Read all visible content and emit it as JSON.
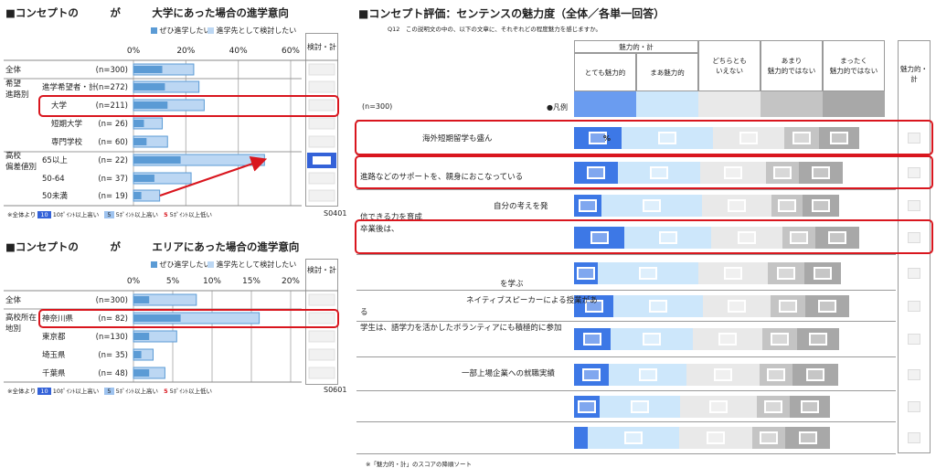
{
  "left_top": {
    "title": "■コンセプトの　　　が　　　大学にあった場合の進学意向",
    "legend": [
      "ぜひ進学したい",
      "進学先として検討したい"
    ],
    "side_header": "検討・計",
    "code": "S0401",
    "footnote": [
      "※全体より",
      "10",
      "10ﾎﾟｲﾝﾄ以上高い",
      "5",
      "5ﾎﾟｲﾝﾄ以上高い",
      "5",
      "5ﾎﾟｲﾝﾄ以上低い"
    ],
    "groups": [
      "希望\n進路別",
      "高校\n偏差値別"
    ]
  },
  "left_bottom": {
    "title": "■コンセプトの　　　が　　　エリアにあった場合の進学意向",
    "legend": [
      "ぜひ進学したい",
      "進学先として検討したい"
    ],
    "side_header": "検討・計",
    "code": "S0601",
    "footnote": [
      "※全体より",
      "10",
      "10ﾎﾟｲﾝﾄ以上高い",
      "5",
      "5ﾎﾟｲﾝﾄ以上高い",
      "5",
      "5ﾎﾟｲﾝﾄ以上低い"
    ],
    "groups": [
      "高校所在\n地別"
    ]
  },
  "right": {
    "title": "■コンセプト評価：センテンスの魅力度（全体／各単一回答）",
    "question": "Q12　この説明文の中の、以下の文章に、それぞれどの程度魅力を感じますか。",
    "header_group": "魅力的・計",
    "header_total": "魅力的・計",
    "columns": [
      "とても魅力的",
      "まあ魅力的",
      "どちらとも\nいえない",
      "あまり\n魅力的ではない",
      "まったく\n魅力的ではない"
    ],
    "n_label": "(n=300)",
    "legend_label": "●凡例",
    "pct_mark": "%",
    "footnote": "※「魅力的・計」のスコアの降順ソート",
    "rows": [
      "海外短期留学も盛ん",
      "進路などのサポートを、親身におこなっている",
      "自分の考えを発",
      "信できる力を育成",
      "卒業後は、",
      "を学ぶ",
      "ネイティブスピーカーによる授業があ",
      "る",
      "学生は、語学力を活かしたボランティアにも積極的に参加",
      "一部上場企業への就職実績"
    ]
  },
  "chart_data": [
    {
      "type": "bar",
      "title": "■コンセプトの　　　が　　　大学にあった場合の進学意向",
      "xlim": [
        0,
        60
      ],
      "ticks": [
        "0%",
        "20%",
        "40%",
        "60%"
      ],
      "categories": [
        "全体",
        "進学希望者・計",
        "大学",
        "短期大学",
        "専門学校",
        "65以上",
        "50-64",
        "50未満"
      ],
      "n": [
        "(n=300)",
        "(n=272)",
        "(n=211)",
        "(n=  26)",
        "(n=  60)",
        "(n=  22)",
        "(n=  37)",
        "(n=  19)"
      ],
      "series": [
        {
          "name": "ぜひ進学したい",
          "values": [
            11,
            12,
            13,
            4,
            5,
            18,
            8,
            3
          ]
        },
        {
          "name": "進学先として検討したい",
          "values": [
            12,
            13,
            14,
            7,
            8,
            32,
            14,
            7
          ]
        }
      ],
      "colors": [
        "#5b9bd5",
        "#bcd7f3"
      ],
      "highlight_rows": [
        2
      ]
    },
    {
      "type": "bar",
      "title": "■コンセプトの　　　が　　　エリアにあった場合の進学意向",
      "xlim": [
        0,
        20
      ],
      "ticks": [
        "0%",
        "5%",
        "10%",
        "15%",
        "20%"
      ],
      "categories": [
        "全体",
        "神奈川県",
        "東京都",
        "埼玉県",
        "千葉県"
      ],
      "n": [
        "(n=300)",
        "(n=  82)",
        "(n=130)",
        "(n=  35)",
        "(n=  48)"
      ],
      "series": [
        {
          "name": "ぜひ進学したい",
          "values": [
            2,
            6,
            2,
            1,
            2
          ]
        },
        {
          "name": "進学先として検討したい",
          "values": [
            6,
            10,
            3.5,
            1.5,
            2
          ]
        }
      ],
      "colors": [
        "#5b9bd5",
        "#bcd7f3"
      ],
      "highlight_rows": [
        1
      ]
    }
  ]
}
